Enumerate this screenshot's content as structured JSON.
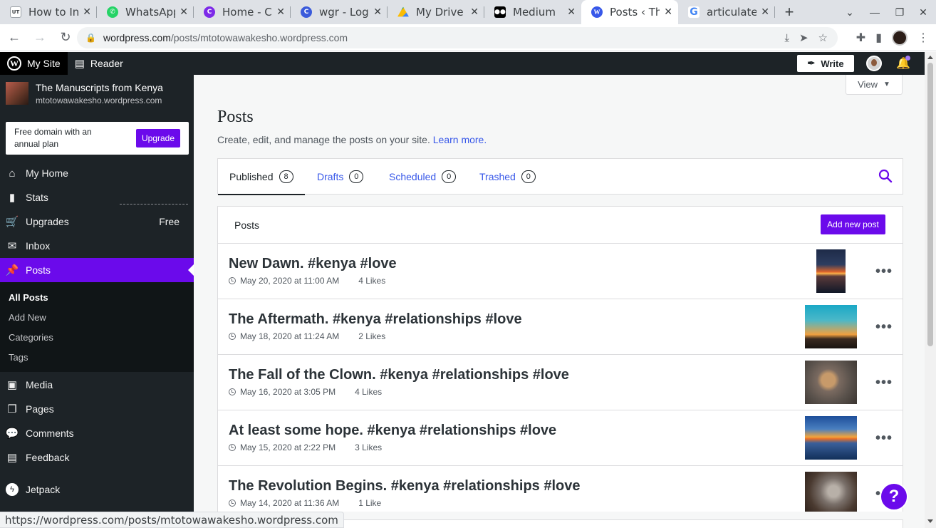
{
  "browser": {
    "tabs": [
      {
        "title": "How to Ins",
        "favicon": "ut-icon",
        "color": "#3c4043",
        "active": false
      },
      {
        "title": "WhatsApp",
        "favicon": "whatsapp-icon",
        "color": "#25d366",
        "active": false
      },
      {
        "title": "Home - Ca",
        "favicon": "canva-icon",
        "color": "#7d2ae8",
        "active": false
      },
      {
        "title": "wgr - Logo",
        "favicon": "canva-icon",
        "color": "#3b5bdb",
        "active": false
      },
      {
        "title": "My Drive -",
        "favicon": "drive-icon",
        "color": "#fbbc04",
        "active": false
      },
      {
        "title": "Medium",
        "favicon": "medium-icon",
        "color": "#000000",
        "active": false
      },
      {
        "title": "Posts ‹ The",
        "favicon": "wordpress-icon",
        "color": "#3858e9",
        "active": true
      },
      {
        "title": "articulate",
        "favicon": "google-icon",
        "color": "#4285f4",
        "active": false
      }
    ],
    "url_host": "wordpress.com",
    "url_path": "/posts/mtotowawakesho.wordpress.com",
    "status_url": "https://wordpress.com/posts/mtotowawakesho.wordpress.com"
  },
  "masterbar": {
    "my_site": "My Site",
    "reader": "Reader",
    "write": "Write"
  },
  "sidebar": {
    "site_name": "The Manuscripts from Kenya",
    "site_url": "mtotowawakesho.wordpress.com",
    "promo_text": "Free domain with an annual plan",
    "upgrade_label": "Upgrade",
    "items": [
      {
        "label": "My Home",
        "icon": "home-icon"
      },
      {
        "label": "Stats",
        "icon": "stats-icon"
      },
      {
        "label": "Upgrades",
        "icon": "cart-icon",
        "badge": "Free"
      },
      {
        "label": "Inbox",
        "icon": "mail-icon"
      },
      {
        "label": "Posts",
        "icon": "pin-icon"
      },
      {
        "label": "Media",
        "icon": "media-icon"
      },
      {
        "label": "Pages",
        "icon": "pages-icon"
      },
      {
        "label": "Comments",
        "icon": "comment-icon"
      },
      {
        "label": "Feedback",
        "icon": "feedback-icon"
      },
      {
        "label": "Jetpack",
        "icon": "jetpack-icon"
      }
    ],
    "submenu": [
      "All Posts",
      "Add New",
      "Categories",
      "Tags"
    ]
  },
  "main": {
    "view_label": "View",
    "title": "Posts",
    "subtitle": "Create, edit, and manage the posts on your site.",
    "learn_more": "Learn more.",
    "tabs": [
      {
        "label": "Published",
        "count": "8"
      },
      {
        "label": "Drafts",
        "count": "0"
      },
      {
        "label": "Scheduled",
        "count": "0"
      },
      {
        "label": "Trashed",
        "count": "0"
      }
    ],
    "list_title": "Posts",
    "add_new": "Add new post",
    "posts": [
      {
        "title": "New Dawn. #kenya #love",
        "date": "May 20, 2020 at 11:00 AM",
        "likes": "4 Likes",
        "thumb": "sunset-sea"
      },
      {
        "title": "The Aftermath. #kenya #relationships #love",
        "date": "May 18, 2020 at 11:24 AM",
        "likes": "2 Likes",
        "thumb": "dusk-walker"
      },
      {
        "title": "The Fall of the Clown. #kenya #relationships #love",
        "date": "May 16, 2020 at 3:05 PM",
        "likes": "4 Likes",
        "thumb": "broken-heart"
      },
      {
        "title": "At least some hope. #kenya #relationships #love",
        "date": "May 15, 2020 at 2:22 PM",
        "likes": "3 Likes",
        "thumb": "lake-sunset"
      },
      {
        "title": "The Revolution Begins. #kenya #relationships #love",
        "date": "May 14, 2020 at 11:36 AM",
        "likes": "1 Like",
        "thumb": "helmet"
      }
    ]
  },
  "help_label": "?"
}
